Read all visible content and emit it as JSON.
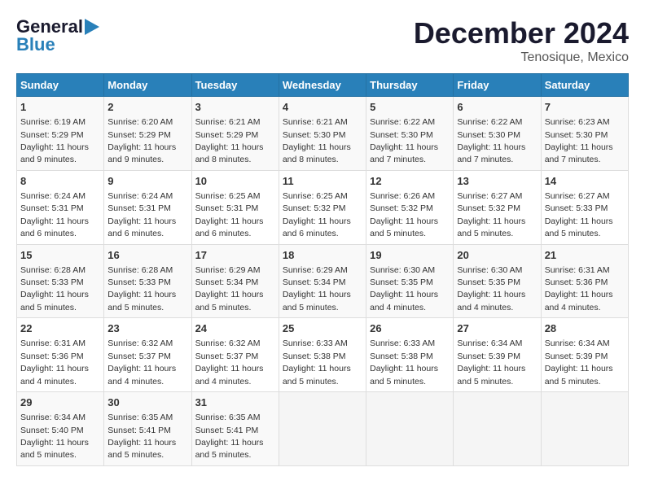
{
  "logo": {
    "text1": "General",
    "text2": "Blue"
  },
  "title": "December 2024",
  "subtitle": "Tenosique, Mexico",
  "days_of_week": [
    "Sunday",
    "Monday",
    "Tuesday",
    "Wednesday",
    "Thursday",
    "Friday",
    "Saturday"
  ],
  "weeks": [
    [
      {
        "day": 1,
        "info": "Sunrise: 6:19 AM\nSunset: 5:29 PM\nDaylight: 11 hours\nand 9 minutes."
      },
      {
        "day": 2,
        "info": "Sunrise: 6:20 AM\nSunset: 5:29 PM\nDaylight: 11 hours\nand 9 minutes."
      },
      {
        "day": 3,
        "info": "Sunrise: 6:21 AM\nSunset: 5:29 PM\nDaylight: 11 hours\nand 8 minutes."
      },
      {
        "day": 4,
        "info": "Sunrise: 6:21 AM\nSunset: 5:30 PM\nDaylight: 11 hours\nand 8 minutes."
      },
      {
        "day": 5,
        "info": "Sunrise: 6:22 AM\nSunset: 5:30 PM\nDaylight: 11 hours\nand 7 minutes."
      },
      {
        "day": 6,
        "info": "Sunrise: 6:22 AM\nSunset: 5:30 PM\nDaylight: 11 hours\nand 7 minutes."
      },
      {
        "day": 7,
        "info": "Sunrise: 6:23 AM\nSunset: 5:30 PM\nDaylight: 11 hours\nand 7 minutes."
      }
    ],
    [
      {
        "day": 8,
        "info": "Sunrise: 6:24 AM\nSunset: 5:31 PM\nDaylight: 11 hours\nand 6 minutes."
      },
      {
        "day": 9,
        "info": "Sunrise: 6:24 AM\nSunset: 5:31 PM\nDaylight: 11 hours\nand 6 minutes."
      },
      {
        "day": 10,
        "info": "Sunrise: 6:25 AM\nSunset: 5:31 PM\nDaylight: 11 hours\nand 6 minutes."
      },
      {
        "day": 11,
        "info": "Sunrise: 6:25 AM\nSunset: 5:32 PM\nDaylight: 11 hours\nand 6 minutes."
      },
      {
        "day": 12,
        "info": "Sunrise: 6:26 AM\nSunset: 5:32 PM\nDaylight: 11 hours\nand 5 minutes."
      },
      {
        "day": 13,
        "info": "Sunrise: 6:27 AM\nSunset: 5:32 PM\nDaylight: 11 hours\nand 5 minutes."
      },
      {
        "day": 14,
        "info": "Sunrise: 6:27 AM\nSunset: 5:33 PM\nDaylight: 11 hours\nand 5 minutes."
      }
    ],
    [
      {
        "day": 15,
        "info": "Sunrise: 6:28 AM\nSunset: 5:33 PM\nDaylight: 11 hours\nand 5 minutes."
      },
      {
        "day": 16,
        "info": "Sunrise: 6:28 AM\nSunset: 5:33 PM\nDaylight: 11 hours\nand 5 minutes."
      },
      {
        "day": 17,
        "info": "Sunrise: 6:29 AM\nSunset: 5:34 PM\nDaylight: 11 hours\nand 5 minutes."
      },
      {
        "day": 18,
        "info": "Sunrise: 6:29 AM\nSunset: 5:34 PM\nDaylight: 11 hours\nand 5 minutes."
      },
      {
        "day": 19,
        "info": "Sunrise: 6:30 AM\nSunset: 5:35 PM\nDaylight: 11 hours\nand 4 minutes."
      },
      {
        "day": 20,
        "info": "Sunrise: 6:30 AM\nSunset: 5:35 PM\nDaylight: 11 hours\nand 4 minutes."
      },
      {
        "day": 21,
        "info": "Sunrise: 6:31 AM\nSunset: 5:36 PM\nDaylight: 11 hours\nand 4 minutes."
      }
    ],
    [
      {
        "day": 22,
        "info": "Sunrise: 6:31 AM\nSunset: 5:36 PM\nDaylight: 11 hours\nand 4 minutes."
      },
      {
        "day": 23,
        "info": "Sunrise: 6:32 AM\nSunset: 5:37 PM\nDaylight: 11 hours\nand 4 minutes."
      },
      {
        "day": 24,
        "info": "Sunrise: 6:32 AM\nSunset: 5:37 PM\nDaylight: 11 hours\nand 4 minutes."
      },
      {
        "day": 25,
        "info": "Sunrise: 6:33 AM\nSunset: 5:38 PM\nDaylight: 11 hours\nand 5 minutes."
      },
      {
        "day": 26,
        "info": "Sunrise: 6:33 AM\nSunset: 5:38 PM\nDaylight: 11 hours\nand 5 minutes."
      },
      {
        "day": 27,
        "info": "Sunrise: 6:34 AM\nSunset: 5:39 PM\nDaylight: 11 hours\nand 5 minutes."
      },
      {
        "day": 28,
        "info": "Sunrise: 6:34 AM\nSunset: 5:39 PM\nDaylight: 11 hours\nand 5 minutes."
      }
    ],
    [
      {
        "day": 29,
        "info": "Sunrise: 6:34 AM\nSunset: 5:40 PM\nDaylight: 11 hours\nand 5 minutes."
      },
      {
        "day": 30,
        "info": "Sunrise: 6:35 AM\nSunset: 5:41 PM\nDaylight: 11 hours\nand 5 minutes."
      },
      {
        "day": 31,
        "info": "Sunrise: 6:35 AM\nSunset: 5:41 PM\nDaylight: 11 hours\nand 5 minutes."
      },
      null,
      null,
      null,
      null
    ]
  ]
}
